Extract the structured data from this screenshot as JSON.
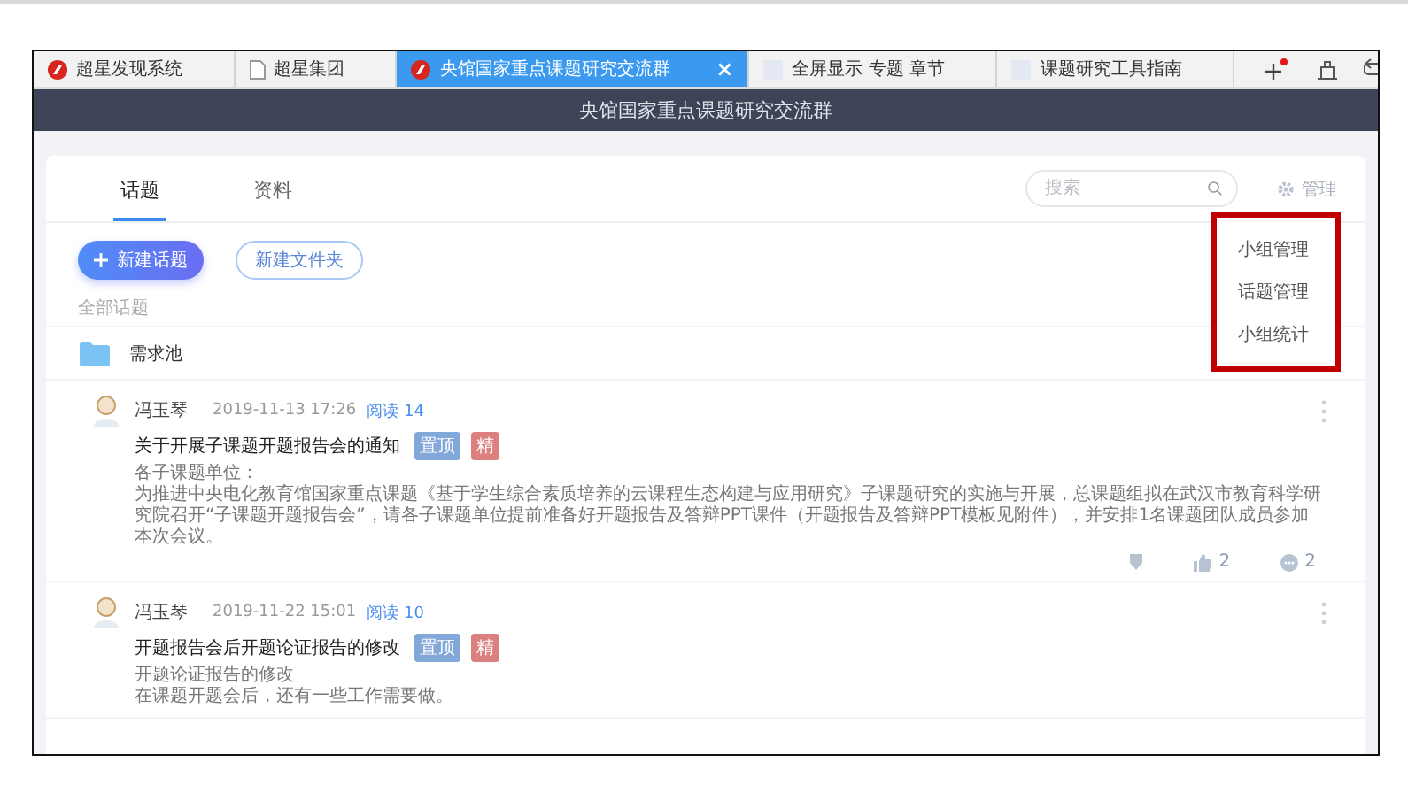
{
  "browser_tabs": [
    {
      "label": "超星发现系统",
      "kind": "logo",
      "selected": false
    },
    {
      "label": "超星集团",
      "kind": "page",
      "selected": false
    },
    {
      "label": "央馆国家重点课题研究交流群",
      "kind": "logo",
      "selected": true,
      "close": "×"
    },
    {
      "label": "全屏显示 专题 章节",
      "kind": "blank",
      "selected": false
    },
    {
      "label": "课题研究工具指南",
      "kind": "blank",
      "selected": false
    }
  ],
  "header": {
    "title": "央馆国家重点课题研究交流群"
  },
  "content_tabs": [
    {
      "label": "话题",
      "selected": true
    },
    {
      "label": "资料",
      "selected": false
    }
  ],
  "search": {
    "placeholder": "搜索"
  },
  "manage": "管理",
  "manage_menu": [
    "小组管理",
    "话题管理",
    "小组统计"
  ],
  "actions": {
    "new_topic": "新建话题",
    "new_folder": "新建文件夹"
  },
  "section_label": "全部话题",
  "folders": [
    {
      "name": "需求池"
    }
  ],
  "posts": [
    {
      "author": "冯玉琴",
      "time": "2019-11-13 17:26",
      "reads": "阅读 14",
      "title": "关于开展子课题开题报告会的通知",
      "tags": [
        {
          "label": "置顶",
          "kind": "pinned"
        },
        {
          "label": "精",
          "kind": "featured"
        }
      ],
      "body": [
        "各子课题单位：",
        "为推进中央电化教育馆国家重点课题《基于学生综合素质培养的云课程生态构建与应用研究》子课题研究的实施与开展，总课题组拟在武汉市教育科学研究院召开“子课题开题报告会”，请各子课题单位提前准备好开题报告及答辩PPT课件（开题报告及答辩PPT模板见附件），并安排1名课题团队成员参加本次会议。"
      ],
      "likes": "2",
      "comments": "2"
    },
    {
      "author": "冯玉琴",
      "time": "2019-11-22 15:01",
      "reads": "阅读 10",
      "title": "开题报告会后开题论证报告的修改",
      "tags": [
        {
          "label": "置顶",
          "kind": "pinned"
        },
        {
          "label": "精",
          "kind": "featured"
        }
      ],
      "body": [
        "开题论证报告的修改",
        "在课题开题会后，还有一些工作需要做。"
      ]
    }
  ]
}
